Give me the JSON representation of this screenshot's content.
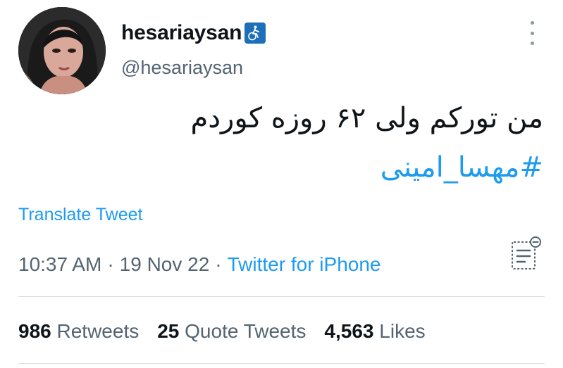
{
  "user": {
    "display_name": "hesariaysan",
    "handle": "@hesariaysan",
    "avatar_icon": "profile-photo",
    "badge_icon": "accessibility-bicycle-icon",
    "badge_color": "#1d6fb8"
  },
  "tweet": {
    "text": "من تورکم ولی ۶۲ روزه کوردم",
    "hashtag": "#مهسا_امینی",
    "translate_label": "Translate Tweet"
  },
  "meta": {
    "time": "10:37 AM",
    "separator": "·",
    "date": "19 Nov 22",
    "source": "Twitter for iPhone"
  },
  "stats": {
    "retweets_count": "986",
    "retweets_label": "Retweets",
    "quotes_count": "25",
    "quotes_label": "Quote Tweets",
    "likes_count": "4,563",
    "likes_label": "Likes"
  },
  "colors": {
    "link": "#1d9bf0",
    "secondary_text": "#536471",
    "primary_text": "#0f1419"
  }
}
